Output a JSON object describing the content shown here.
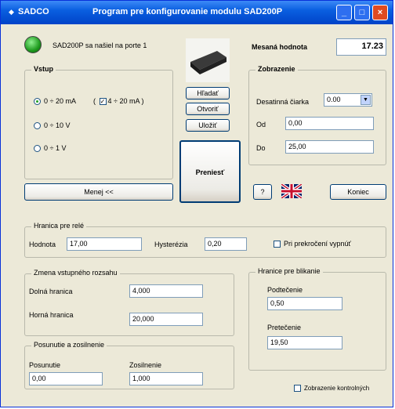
{
  "window": {
    "app_name": "SADCO",
    "title": "Program pre konfigurovanie modulu SAD200P",
    "min": "_",
    "max": "□",
    "close": "×"
  },
  "status": {
    "text": "SAD200P sa našiel na porte 1"
  },
  "measured": {
    "label": "Mesaná hodnota",
    "value": "17.23"
  },
  "vstup": {
    "title": "Vstup",
    "options": [
      "0 ÷ 20 mA",
      "0 ÷ 10 V",
      "0 ÷ 1 V"
    ],
    "selected": 0,
    "check_open": "(",
    "check_label": "4 ÷ 20 mA )"
  },
  "device_buttons": {
    "find": "Hľadať",
    "open": "Otvoriť",
    "save": "Uložiť",
    "transfer": "Preniesť"
  },
  "zobrazenie": {
    "title": "Zobrazenie",
    "decimal_label": "Desatinná čiarka",
    "decimal_value": "0.00",
    "from_label": "Od",
    "from_value": "0,00",
    "to_label": "Do",
    "to_value": "25,00"
  },
  "less_button": "Menej <<",
  "help_button": "?",
  "end_button": "Koniec",
  "relay": {
    "title": "Hranica pre relé",
    "value_label": "Hodnota",
    "value": "17,00",
    "hyst_label": "Hysterézia",
    "hyst_value": "0,20",
    "off_label": "Pri prekročení vypnúť"
  },
  "range": {
    "title": "Zmena vstupného rozsahu",
    "lower_label": "Dolná hranica",
    "lower_value": "4,000",
    "upper_label": "Horná hranica",
    "upper_value": "20,000"
  },
  "blink": {
    "title": "Hranice pre blikanie",
    "under_label": "Podtečenie",
    "under_value": "0,50",
    "over_label": "Pretečenie",
    "over_value": "19,50"
  },
  "shift": {
    "title": "Posunutie a zosilnenie",
    "shift_label": "Posunutie",
    "shift_value": "0,00",
    "gain_label": "Zosilnenie",
    "gain_value": "1,000"
  },
  "calib_label": "Zobrazenie kontrolných"
}
